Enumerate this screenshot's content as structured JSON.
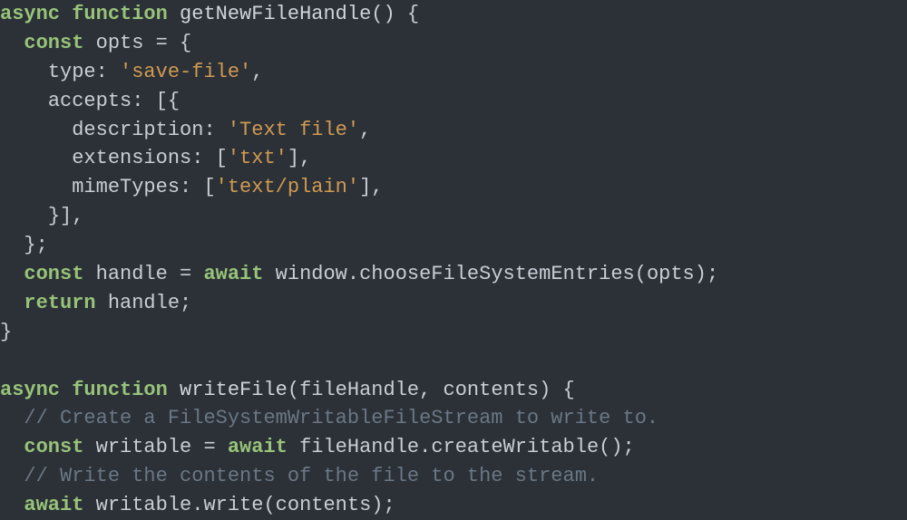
{
  "code": {
    "language": "javascript",
    "theme": "dark",
    "tokens": [
      [
        {
          "t": "kw",
          "s": "async"
        },
        {
          "t": "sp",
          "s": " "
        },
        {
          "t": "kw",
          "s": "function"
        },
        {
          "t": "sp",
          "s": " "
        },
        {
          "t": "fn",
          "s": "getNewFileHandle"
        },
        {
          "t": "pn",
          "s": "()"
        },
        {
          "t": "sp",
          "s": " "
        },
        {
          "t": "pn",
          "s": "{"
        }
      ],
      [
        {
          "t": "sp",
          "s": "  "
        },
        {
          "t": "kw",
          "s": "const"
        },
        {
          "t": "sp",
          "s": " "
        },
        {
          "t": "id",
          "s": "opts"
        },
        {
          "t": "sp",
          "s": " "
        },
        {
          "t": "op",
          "s": "="
        },
        {
          "t": "sp",
          "s": " "
        },
        {
          "t": "pn",
          "s": "{"
        }
      ],
      [
        {
          "t": "sp",
          "s": "    "
        },
        {
          "t": "id",
          "s": "type"
        },
        {
          "t": "pn",
          "s": ":"
        },
        {
          "t": "sp",
          "s": " "
        },
        {
          "t": "str",
          "s": "'save-file'"
        },
        {
          "t": "pn",
          "s": ","
        }
      ],
      [
        {
          "t": "sp",
          "s": "    "
        },
        {
          "t": "id",
          "s": "accepts"
        },
        {
          "t": "pn",
          "s": ":"
        },
        {
          "t": "sp",
          "s": " "
        },
        {
          "t": "pn",
          "s": "[{"
        }
      ],
      [
        {
          "t": "sp",
          "s": "      "
        },
        {
          "t": "id",
          "s": "description"
        },
        {
          "t": "pn",
          "s": ":"
        },
        {
          "t": "sp",
          "s": " "
        },
        {
          "t": "str",
          "s": "'Text file'"
        },
        {
          "t": "pn",
          "s": ","
        }
      ],
      [
        {
          "t": "sp",
          "s": "      "
        },
        {
          "t": "id",
          "s": "extensions"
        },
        {
          "t": "pn",
          "s": ":"
        },
        {
          "t": "sp",
          "s": " "
        },
        {
          "t": "pn",
          "s": "["
        },
        {
          "t": "str",
          "s": "'txt'"
        },
        {
          "t": "pn",
          "s": "],"
        }
      ],
      [
        {
          "t": "sp",
          "s": "      "
        },
        {
          "t": "id",
          "s": "mimeTypes"
        },
        {
          "t": "pn",
          "s": ":"
        },
        {
          "t": "sp",
          "s": " "
        },
        {
          "t": "pn",
          "s": "["
        },
        {
          "t": "str",
          "s": "'text/plain'"
        },
        {
          "t": "pn",
          "s": "],"
        }
      ],
      [
        {
          "t": "sp",
          "s": "    "
        },
        {
          "t": "pn",
          "s": "}],"
        }
      ],
      [
        {
          "t": "sp",
          "s": "  "
        },
        {
          "t": "pn",
          "s": "};"
        }
      ],
      [
        {
          "t": "sp",
          "s": "  "
        },
        {
          "t": "kw",
          "s": "const"
        },
        {
          "t": "sp",
          "s": " "
        },
        {
          "t": "id",
          "s": "handle"
        },
        {
          "t": "sp",
          "s": " "
        },
        {
          "t": "op",
          "s": "="
        },
        {
          "t": "sp",
          "s": " "
        },
        {
          "t": "kw",
          "s": "await"
        },
        {
          "t": "sp",
          "s": " "
        },
        {
          "t": "id",
          "s": "window"
        },
        {
          "t": "pn",
          "s": "."
        },
        {
          "t": "id",
          "s": "chooseFileSystemEntries"
        },
        {
          "t": "pn",
          "s": "("
        },
        {
          "t": "id",
          "s": "opts"
        },
        {
          "t": "pn",
          "s": ");"
        }
      ],
      [
        {
          "t": "sp",
          "s": "  "
        },
        {
          "t": "kw",
          "s": "return"
        },
        {
          "t": "sp",
          "s": " "
        },
        {
          "t": "id",
          "s": "handle"
        },
        {
          "t": "pn",
          "s": ";"
        }
      ],
      [
        {
          "t": "pn",
          "s": "}"
        }
      ],
      [
        {
          "t": "sp",
          "s": ""
        }
      ],
      [
        {
          "t": "kw",
          "s": "async"
        },
        {
          "t": "sp",
          "s": " "
        },
        {
          "t": "kw",
          "s": "function"
        },
        {
          "t": "sp",
          "s": " "
        },
        {
          "t": "fn",
          "s": "writeFile"
        },
        {
          "t": "pn",
          "s": "("
        },
        {
          "t": "id",
          "s": "fileHandle"
        },
        {
          "t": "pn",
          "s": ","
        },
        {
          "t": "sp",
          "s": " "
        },
        {
          "t": "id",
          "s": "contents"
        },
        {
          "t": "pn",
          "s": ")"
        },
        {
          "t": "sp",
          "s": " "
        },
        {
          "t": "pn",
          "s": "{"
        }
      ],
      [
        {
          "t": "sp",
          "s": "  "
        },
        {
          "t": "cm",
          "s": "// Create a FileSystemWritableFileStream to write to."
        }
      ],
      [
        {
          "t": "sp",
          "s": "  "
        },
        {
          "t": "kw",
          "s": "const"
        },
        {
          "t": "sp",
          "s": " "
        },
        {
          "t": "id",
          "s": "writable"
        },
        {
          "t": "sp",
          "s": " "
        },
        {
          "t": "op",
          "s": "="
        },
        {
          "t": "sp",
          "s": " "
        },
        {
          "t": "kw",
          "s": "await"
        },
        {
          "t": "sp",
          "s": " "
        },
        {
          "t": "id",
          "s": "fileHandle"
        },
        {
          "t": "pn",
          "s": "."
        },
        {
          "t": "id",
          "s": "createWritable"
        },
        {
          "t": "pn",
          "s": "();"
        }
      ],
      [
        {
          "t": "sp",
          "s": "  "
        },
        {
          "t": "cm",
          "s": "// Write the contents of the file to the stream."
        }
      ],
      [
        {
          "t": "sp",
          "s": "  "
        },
        {
          "t": "kw",
          "s": "await"
        },
        {
          "t": "sp",
          "s": " "
        },
        {
          "t": "id",
          "s": "writable"
        },
        {
          "t": "pn",
          "s": "."
        },
        {
          "t": "id",
          "s": "write"
        },
        {
          "t": "pn",
          "s": "("
        },
        {
          "t": "id",
          "s": "contents"
        },
        {
          "t": "pn",
          "s": ");"
        }
      ]
    ]
  }
}
